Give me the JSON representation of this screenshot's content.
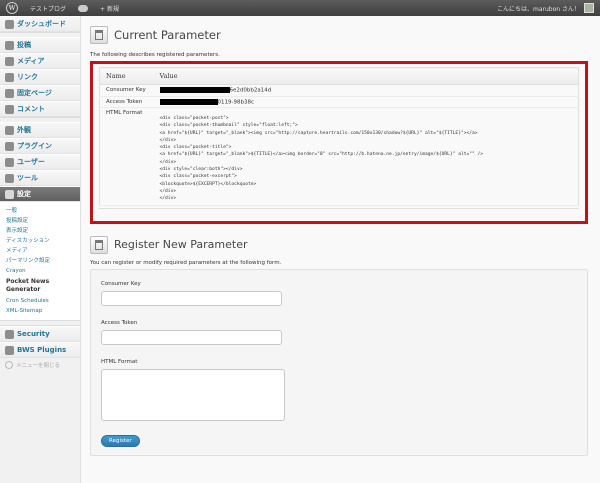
{
  "adminbar": {
    "logo": "W",
    "site_name": "テストブログ",
    "new_label": "+ 新規",
    "greeting": "こんにちは、marubon さん！"
  },
  "sidebar": {
    "dashboard": "ダッシュボード",
    "group2": [
      "投稿",
      "メディア",
      "リンク",
      "固定ページ",
      "コメント"
    ],
    "group3": [
      "外観",
      "プラグイン",
      "ユーザー",
      "ツール"
    ],
    "settings": "設定",
    "submenu": [
      "一般",
      "投稿設定",
      "表示設定",
      "ディスカッション",
      "メディア",
      "パーマリンク設定",
      "Crayon"
    ],
    "submenu_active": "Pocket News Generator",
    "submenu_after": [
      "Cron Schedules",
      "XML-Sitemap"
    ],
    "security": "Security",
    "bws": "BWS Plugins",
    "collapse": "メニューを閉じる"
  },
  "current": {
    "title": "Current Parameter",
    "description": "The following describes registered parameters.",
    "col_name": "Name",
    "col_value": "Value",
    "consumer_key_label": "Consumer Key",
    "consumer_key_suffix": "6e2d0bb2a14d",
    "access_token_label": "Access Token",
    "access_token_suffix": "0119-98b38c",
    "html_format_label": "HTML Format",
    "html_format_value": "<div class=\"pocket-post\">\n<div class=\"pocket-thumbnail\" style=\"float:left;\">\n<a href=\"${URL}\" target=\"_blank\"><img src=\"http://capture.heartrails.com/150x130/shadow?${URL}\" alt=\"${TITLE}\"></a>\n</div>\n<div class=\"pocket-title\">\n<a href=\"${URL}\" target=\"_blank\">${TITLE}</a><img border=\"0\" src=\"http://b.hatena.ne.jp/entry/image/${URL}\" alt=\"\" />\n</div>\n<div style=\"clear:both\"></div>\n<div class=\"pocket-excerpt\">\n<blockquote>${EXCERPT}</blockquote>\n</div>\n</div>"
  },
  "register": {
    "title": "Register New Parameter",
    "description": "You can register or modify required parameters at the following form.",
    "consumer_key_label": "Consumer Key",
    "consumer_key_value": "",
    "access_token_label": "Access Token",
    "access_token_value": "",
    "html_format_label": "HTML Format",
    "html_format_value": "",
    "button_label": "Register"
  }
}
